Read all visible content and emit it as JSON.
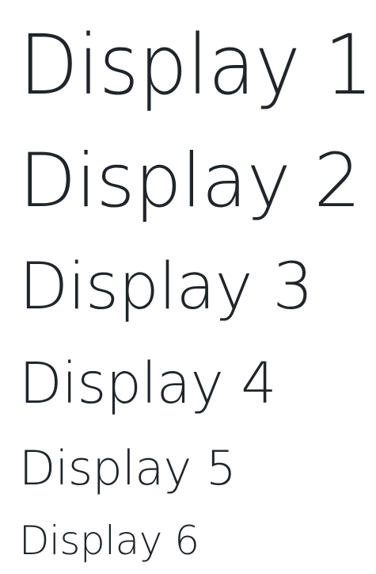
{
  "headings": [
    {
      "level": 1,
      "text": "Display 1"
    },
    {
      "level": 2,
      "text": "Display 2"
    },
    {
      "level": 3,
      "text": "Display 3"
    },
    {
      "level": 4,
      "text": "Display 4"
    },
    {
      "level": 5,
      "text": "Display 5"
    },
    {
      "level": 6,
      "text": "Display 6"
    }
  ],
  "colors": {
    "text": "#212529",
    "background": "#ffffff"
  }
}
